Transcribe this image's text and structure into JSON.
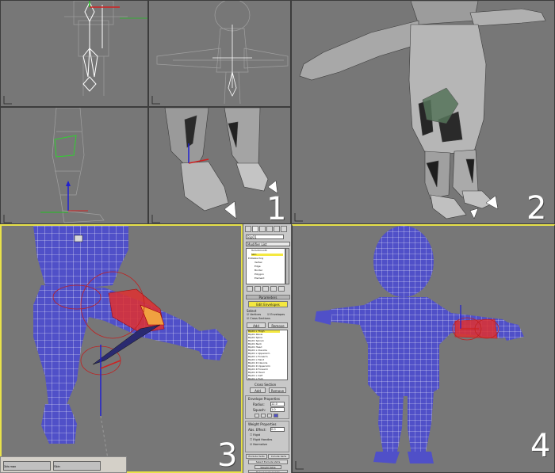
{
  "viewports": {
    "top_left": {
      "label": ""
    },
    "top_mid": {
      "label": ""
    },
    "bottom_left": {
      "label": ""
    },
    "bottom_mid": {
      "label": "1"
    },
    "right_big": {
      "label": "2"
    },
    "pose_left": {
      "label": "3"
    },
    "pose_right": {
      "label": "4"
    }
  },
  "command_panel": {
    "object_name": "Bip01",
    "modifier_list": "Modifier List",
    "stack": [
      "TurboSmooth",
      "Skin",
      "Editable Poly",
      "Vertex",
      "Edge",
      "Border",
      "Polygon",
      "Element"
    ],
    "parameters_title": "Parameters",
    "edit_envelopes": "Edit Envelopes",
    "select_label": "Select",
    "vertices_label": "Vertices",
    "envelopes_label": "Envelopes",
    "cross_sections_label": "Cross Sections",
    "add_label": "Add",
    "remove_label": "Remove",
    "bones": [
      "Bip01 L Thigh",
      "Bip01 Pelvis",
      "Bip01 Spine",
      "Bip01 Spine1",
      "Bip01 Neck",
      "Bip01 Head",
      "Bip01 L Clavicle",
      "Bip01 L UpperArm",
      "Bip01 L Forearm",
      "Bip01 L Hand",
      "Bip01 R Clavicle",
      "Bip01 R UpperArm",
      "Bip01 R Forearm",
      "Bip01 R Hand",
      "Bip01 L Calf",
      "Bip01 L Foot"
    ],
    "cross_section_title": "Cross Section",
    "envelope_props_title": "Envelope Properties",
    "radius_label": "Radius:",
    "radius_value": "12.0",
    "squash_label": "Squash:",
    "squash_value": "1.0",
    "weight_props_title": "Weight Properties",
    "abs_effect_label": "Abs. Effect:",
    "abs_effect_value": "0.0",
    "rigid_label": "Rigid",
    "rigid_handles_label": "Rigid Handles",
    "normalize_label": "Normalize",
    "exclude_verts_label": "Exclude Verts",
    "include_verts_label": "Include Verts",
    "select_excluded_label": "Select Exclude Verts",
    "weight_table_label": "Weight Table",
    "bake_selected_label": "Bake Selected Verts"
  },
  "taskbar": {
    "item1": "3ds max",
    "item2": "Skin"
  },
  "colors": {
    "mesh_blue": "#5050c8",
    "envelope_red": "#e03030",
    "active_border": "#e8e24a",
    "viewport_bg": "#777777"
  }
}
